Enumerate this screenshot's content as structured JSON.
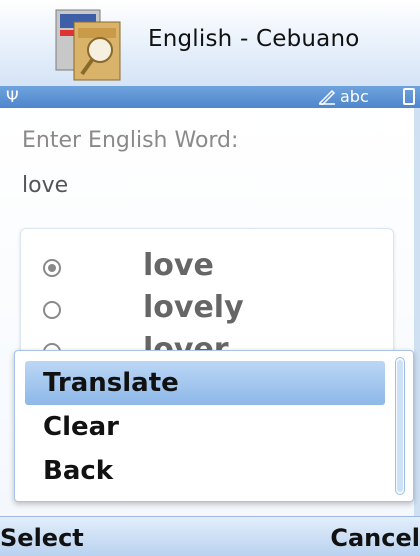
{
  "app": {
    "title": "English - Cebuano",
    "icon": "dictionary-books-icon"
  },
  "status_bar": {
    "signal_icon": "antenna-icon",
    "input_mode": "abc",
    "edit_icon": "pen-icon",
    "battery_icon": "battery-icon"
  },
  "prompt": "Enter English Word:",
  "input": {
    "value": "love",
    "placeholder": ""
  },
  "results": [
    {
      "label": "love",
      "selected": true
    },
    {
      "label": "lovely",
      "selected": false
    },
    {
      "label": "lover",
      "selected": false
    }
  ],
  "menu": {
    "items": [
      "Translate",
      "Clear",
      "Back"
    ],
    "selected_index": 0
  },
  "softkeys": {
    "left": "Select",
    "right": "Cancel"
  },
  "colors": {
    "accent": "#4f86cc",
    "menu_highlight": "#8db8e8"
  }
}
